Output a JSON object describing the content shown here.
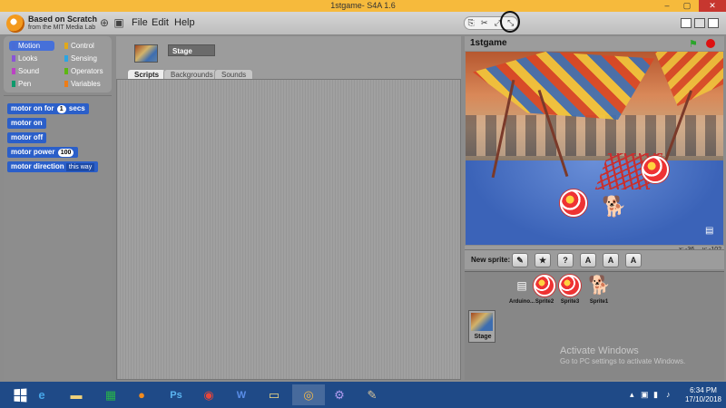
{
  "window": {
    "title": "1stgame- S4A 1.6",
    "minimize": "–",
    "maximize": "▢",
    "close": "✕"
  },
  "header": {
    "brand": "Based on Scratch",
    "brand_sub": "from the MIT Media Lab",
    "menus": [
      "File",
      "Edit",
      "Help"
    ]
  },
  "tools": [
    "copy-icon",
    "cut-icon",
    "grow-icon",
    "shrink-icon"
  ],
  "categories": [
    {
      "label": "Motion",
      "color": "#4a6cd4",
      "selected": true
    },
    {
      "label": "Control",
      "color": "#e1a91a"
    },
    {
      "label": "Looks",
      "color": "#8a55d7"
    },
    {
      "label": "Sensing",
      "color": "#2ca5e2"
    },
    {
      "label": "Sound",
      "color": "#bb42c3"
    },
    {
      "label": "Operators",
      "color": "#5cb712"
    },
    {
      "label": "Pen",
      "color": "#0e9a6c"
    },
    {
      "label": "Variables",
      "color": "#ee7d16"
    }
  ],
  "blocks": {
    "motor_on_for": "motor on for",
    "motor_on_for_value": "1",
    "motor_on_for_unit": "secs",
    "motor_on": "motor on",
    "motor_off": "motor off",
    "motor_power": "motor power",
    "motor_power_value": "100",
    "motor_direction": "motor direction",
    "motor_direction_value": "this way"
  },
  "editor": {
    "sprite_name": "Stage",
    "tabs": [
      "Scripts",
      "Backgrounds",
      "Sounds"
    ],
    "active_tab": "Scripts"
  },
  "stage": {
    "name": "1stgame",
    "x_label": "x:",
    "x_value": "-36",
    "y_label": "y:",
    "y_value": "-102"
  },
  "new_sprite": {
    "label": "New sprite:"
  },
  "sprites": [
    {
      "name": "Arduino...",
      "icon": "arduino-board-icon"
    },
    {
      "name": "Sprite2",
      "icon": "ball-icon"
    },
    {
      "name": "Sprite3",
      "icon": "ball-icon"
    },
    {
      "name": "Sprite1",
      "icon": "dog-icon"
    }
  ],
  "stage_slot": {
    "label": "Stage"
  },
  "watermark": {
    "title": "Activate Windows",
    "sub": "Go to PC settings to activate Windows."
  },
  "taskbar": {
    "time": "6:34 PM",
    "date": "17/10/2018"
  }
}
